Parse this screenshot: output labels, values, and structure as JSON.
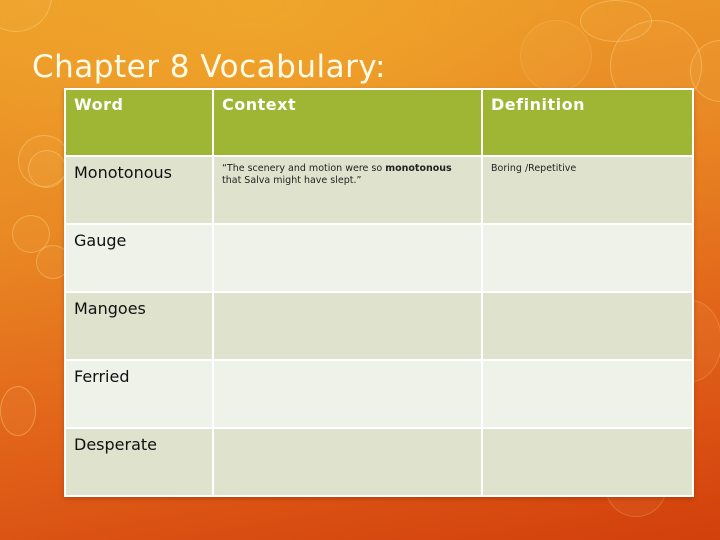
{
  "slide": {
    "title": "Chapter 8 Vocabulary:",
    "colors": {
      "header_bg": "#9fb534",
      "row_odd_bg": "#dfe3cd",
      "row_even_bg": "#eff2e8",
      "title_text": "#fffbe8"
    }
  },
  "table": {
    "headers": [
      "Word",
      "Context",
      "Definition"
    ],
    "rows": [
      {
        "word": "Monotonous",
        "context_before": "“The scenery and motion were so ",
        "context_bold": "monotonous",
        "context_after": " that Salva might have slept.”",
        "definition": "Boring /Repetitive"
      },
      {
        "word": "Gauge",
        "context_before": "",
        "context_bold": "",
        "context_after": "",
        "definition": ""
      },
      {
        "word": "Mangoes",
        "context_before": "",
        "context_bold": "",
        "context_after": "",
        "definition": ""
      },
      {
        "word": "Ferried",
        "context_before": "",
        "context_bold": "",
        "context_after": "",
        "definition": ""
      },
      {
        "word": "Desperate",
        "context_before": "",
        "context_bold": "",
        "context_after": "",
        "definition": ""
      }
    ]
  }
}
